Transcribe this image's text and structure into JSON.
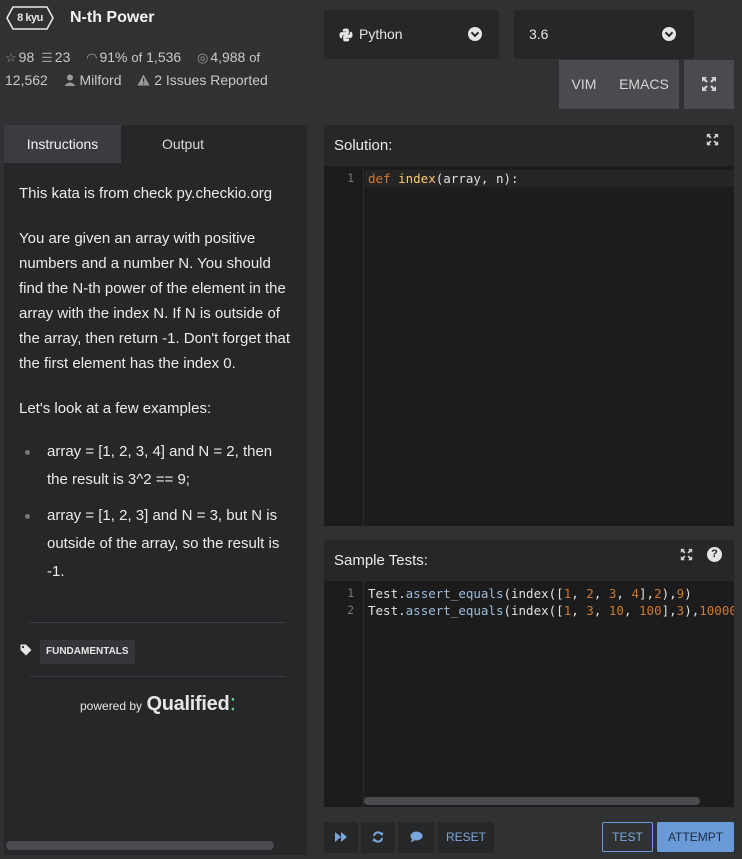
{
  "header": {
    "rank": "8 kyu",
    "title": "N-th Power",
    "stats": {
      "stars": "98",
      "collections": "23",
      "satisfaction": "91%",
      "of_label": "of",
      "votes": "1,536",
      "completed": "4,988",
      "attempted": "12,562",
      "author": "Milford",
      "issues": "2 Issues Reported"
    }
  },
  "language": {
    "selected": "Python",
    "version": "3.6"
  },
  "editor_modes": {
    "vim": "VIM",
    "emacs": "EMACS"
  },
  "tabs": {
    "instructions": "Instructions",
    "output": "Output"
  },
  "instructions": {
    "p1": "This kata is from check py.checkio.org",
    "p2": "You are given an array with positive numbers and a number N. You should find the N-th power of the element in the array with the index N. If N is outside of the array, then return -1. Don't forget that the first element has the index 0.",
    "p3": "Let's look at a few examples:",
    "examples": [
      "array = [1, 2, 3, 4] and N = 2, then the result is 3^2 == 9;",
      "array = [1, 2, 3] and N = 3, but N is outside of the array, so the result is -1."
    ],
    "tag": "FUNDAMENTALS",
    "powered_by": "powered by",
    "brand": "Qualified"
  },
  "solution": {
    "title": "Solution:",
    "line_numbers": [
      "1"
    ]
  },
  "sample_tests": {
    "title": "Sample Tests:",
    "line_numbers": [
      "1",
      "2"
    ]
  },
  "toolbar": {
    "reset": "RESET",
    "test": "TEST",
    "attempt": "ATTEMPT"
  },
  "icons": {
    "kyu_badge": "hexagon-badge",
    "star": "star-icon",
    "collections": "stack-icon",
    "satisfaction": "gauge-icon",
    "completed": "target-icon",
    "author": "user-icon",
    "issues": "warning-icon",
    "python": "python-icon",
    "expand": "expand-icon",
    "help": "help-icon",
    "tag": "tag-icon",
    "skip": "fast-forward-icon",
    "refresh": "refresh-icon",
    "chat": "chat-icon"
  },
  "colors": {
    "accent": "#6a9bd8",
    "brand_dots": "#5bd08a"
  }
}
